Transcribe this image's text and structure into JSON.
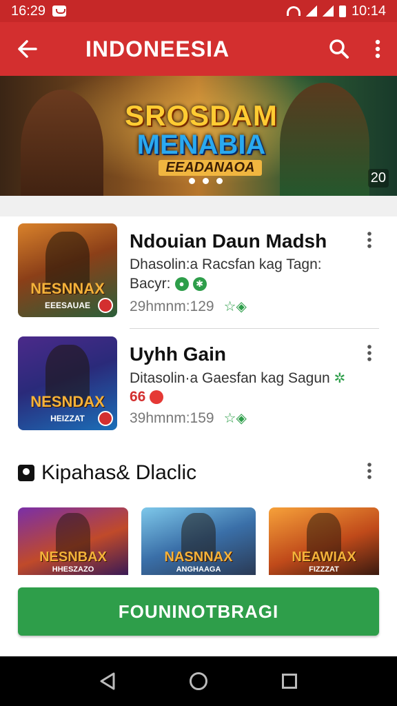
{
  "status": {
    "time_left": "16:29",
    "time_right": "10:14"
  },
  "app_bar": {
    "title": "INDONEESIA",
    "back_icon": "arrow-left-icon",
    "search_icon": "search-icon",
    "more_icon": "more-vertical-icon"
  },
  "banner": {
    "line1": "SROSDAM",
    "line2": "MENABIA",
    "line3": "EEADANAOA",
    "count": "20"
  },
  "games": [
    {
      "title": "Ndouian Daun Madsh",
      "desc": "Dhasolin:a Racsfan kag Tagn:",
      "line2": "Bacyr:",
      "meta": "29hmnm:129",
      "thumb_title": "NESNNAX",
      "thumb_sub": "EEESAUAE"
    },
    {
      "title": "Uyhh Gain",
      "desc": "Ditasolin·a Gaesfan kag Sagun",
      "rating": "66",
      "meta": "39hmnm:159",
      "thumb_title": "NESNDAX",
      "thumb_sub": "HEIZZAT"
    }
  ],
  "section": {
    "title": "Kipahas& Dlaclic",
    "tiles": [
      {
        "title": "NESNBAX",
        "sub": "HHESZAZO"
      },
      {
        "title": "NASNNAX",
        "sub": "ANGHAAGA"
      },
      {
        "title": "NEAWIAX",
        "sub": "FIZZZAT"
      }
    ]
  },
  "cta": {
    "label": "FOUNINOTBRAGI"
  },
  "colors": {
    "app_bar": "#d32f2f",
    "status_bar": "#c62828",
    "cta": "#2e9e4a"
  }
}
